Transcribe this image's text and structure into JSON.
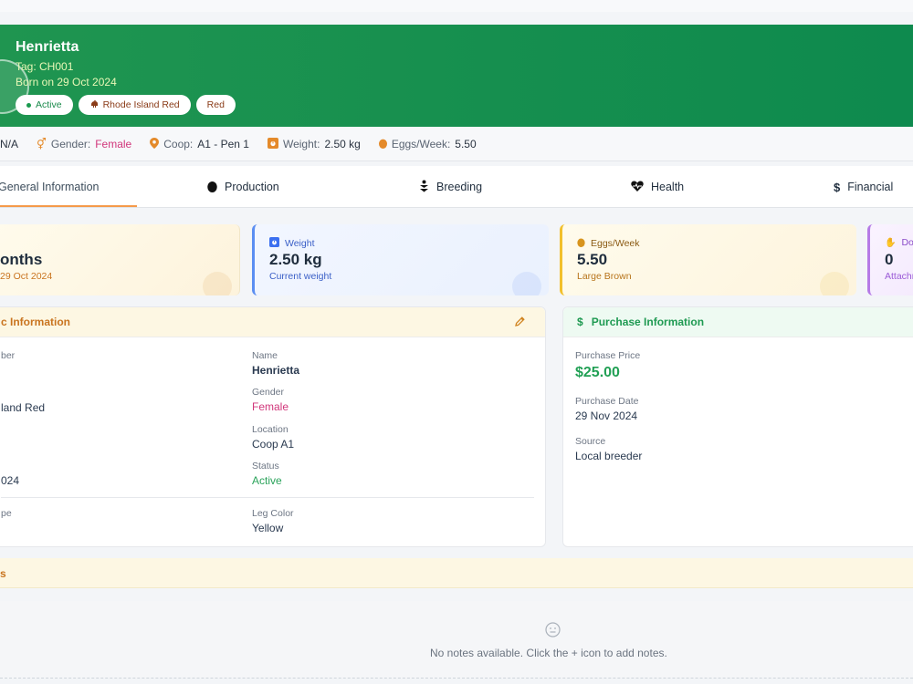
{
  "hero": {
    "name": "Henrietta",
    "tag": "Tag: CH001",
    "born": "Born on 29 Oct 2024",
    "pills": [
      {
        "label": "Active",
        "icon": "dot-icon"
      },
      {
        "label": "Rhode Island Red",
        "icon": "chicken-icon"
      },
      {
        "label": "Red",
        "icon": ""
      }
    ]
  },
  "stats": [
    {
      "label": "",
      "value": "N/A",
      "icon": "",
      "color": ""
    },
    {
      "label": "Gender:",
      "value": "Female",
      "icon": "gender-icon",
      "color": "pink"
    },
    {
      "label": "Coop:",
      "value": "A1 - Pen 1",
      "icon": "location-pin-icon",
      "color": ""
    },
    {
      "label": "Weight:",
      "value": "2.50 kg",
      "icon": "scale-icon",
      "color": ""
    },
    {
      "label": "Eggs/Week:",
      "value": "5.50",
      "icon": "egg-icon",
      "color": ""
    }
  ],
  "tabs": [
    {
      "label": "General Information",
      "icon": ""
    },
    {
      "label": "Production",
      "icon": "egg-icon"
    },
    {
      "label": "Breeding",
      "icon": "breeding-icon"
    },
    {
      "label": "Health",
      "icon": "heart-pulse-icon"
    },
    {
      "label": "Financial",
      "icon": "dollar-icon"
    }
  ],
  "summary_cards": {
    "age": {
      "big": "onths",
      "sub": "29 Oct 2024"
    },
    "weight": {
      "label": "Weight",
      "big": "2.50 kg",
      "sub": "Current weight"
    },
    "eggs": {
      "label": "Eggs/Week",
      "big": "5.50",
      "sub": "Large Brown"
    },
    "docs": {
      "label": "Doc",
      "big": "0",
      "sub": "Attachm"
    }
  },
  "basic_info": {
    "title": "c Information",
    "fields_left": [
      {
        "label": "ber",
        "value": ""
      },
      {
        "label": "",
        "value": "land Red"
      },
      {
        "label": "",
        "value": ""
      },
      {
        "label": "",
        "value": "024"
      },
      {
        "label": "pe",
        "value": ""
      }
    ],
    "name_label": "Name",
    "name_value": "Henrietta",
    "gender_label": "Gender",
    "gender_value": "Female",
    "location_label": "Location",
    "location_value": "Coop A1",
    "status_label": "Status",
    "status_value": "Active",
    "legcolor_label": "Leg Color",
    "legcolor_value": "Yellow"
  },
  "purchase_info": {
    "title": "Purchase Information",
    "price_label": "Purchase Price",
    "price_value": "$25.00",
    "date_label": "Purchase Date",
    "date_value": "29 Nov 2024",
    "source_label": "Source",
    "source_value": "Local breeder"
  },
  "notes": {
    "title": "s",
    "empty_message": "No notes available. Click the + icon to add notes."
  }
}
